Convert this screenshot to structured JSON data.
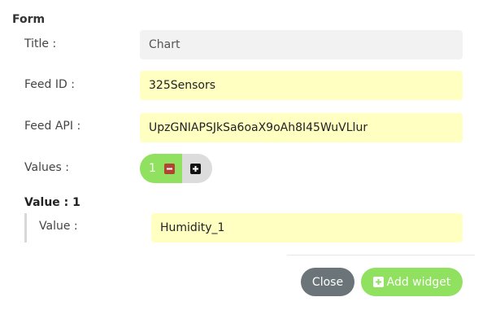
{
  "form": {
    "title": "Form",
    "title_label": "Title :",
    "title_value": "Chart",
    "feed_id_label": "Feed ID :",
    "feed_id_value": "325Sensors",
    "feed_api_label": "Feed API :",
    "feed_api_value": "UpzGNIAPSJkSa6oaX9oAh8I45WuVLlur",
    "values_label": "Values :",
    "values_count": "1",
    "value_section_title": "Value : 1",
    "value_label": "Value :",
    "value_value": "Humidity_1"
  },
  "icons": {
    "decrement": "minus-icon",
    "increment": "plus-icon",
    "add_widget": "plus-square-icon"
  },
  "buttons": {
    "close_label": "Close",
    "add_widget_label": "Add widget"
  },
  "colors": {
    "accent_green": "#8fe15f",
    "input_yellow": "#ffffc2",
    "close_gray": "#6b7479",
    "minus_red": "#b34434"
  }
}
